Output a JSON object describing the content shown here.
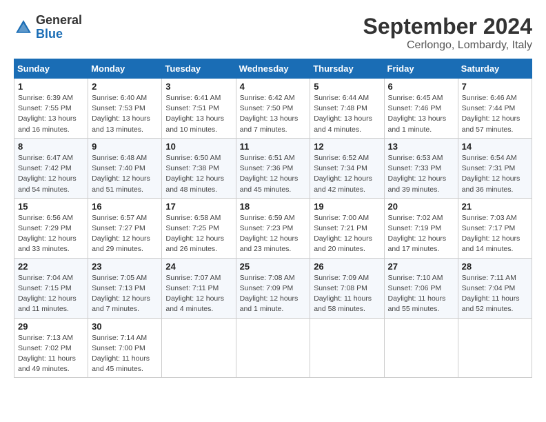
{
  "header": {
    "logo_general": "General",
    "logo_blue": "Blue",
    "month_year": "September 2024",
    "location": "Cerlongo, Lombardy, Italy"
  },
  "weekdays": [
    "Sunday",
    "Monday",
    "Tuesday",
    "Wednesday",
    "Thursday",
    "Friday",
    "Saturday"
  ],
  "weeks": [
    [
      {
        "day": "1",
        "info": "Sunrise: 6:39 AM\nSunset: 7:55 PM\nDaylight: 13 hours\nand 16 minutes."
      },
      {
        "day": "2",
        "info": "Sunrise: 6:40 AM\nSunset: 7:53 PM\nDaylight: 13 hours\nand 13 minutes."
      },
      {
        "day": "3",
        "info": "Sunrise: 6:41 AM\nSunset: 7:51 PM\nDaylight: 13 hours\nand 10 minutes."
      },
      {
        "day": "4",
        "info": "Sunrise: 6:42 AM\nSunset: 7:50 PM\nDaylight: 13 hours\nand 7 minutes."
      },
      {
        "day": "5",
        "info": "Sunrise: 6:44 AM\nSunset: 7:48 PM\nDaylight: 13 hours\nand 4 minutes."
      },
      {
        "day": "6",
        "info": "Sunrise: 6:45 AM\nSunset: 7:46 PM\nDaylight: 13 hours\nand 1 minute."
      },
      {
        "day": "7",
        "info": "Sunrise: 6:46 AM\nSunset: 7:44 PM\nDaylight: 12 hours\nand 57 minutes."
      }
    ],
    [
      {
        "day": "8",
        "info": "Sunrise: 6:47 AM\nSunset: 7:42 PM\nDaylight: 12 hours\nand 54 minutes."
      },
      {
        "day": "9",
        "info": "Sunrise: 6:48 AM\nSunset: 7:40 PM\nDaylight: 12 hours\nand 51 minutes."
      },
      {
        "day": "10",
        "info": "Sunrise: 6:50 AM\nSunset: 7:38 PM\nDaylight: 12 hours\nand 48 minutes."
      },
      {
        "day": "11",
        "info": "Sunrise: 6:51 AM\nSunset: 7:36 PM\nDaylight: 12 hours\nand 45 minutes."
      },
      {
        "day": "12",
        "info": "Sunrise: 6:52 AM\nSunset: 7:34 PM\nDaylight: 12 hours\nand 42 minutes."
      },
      {
        "day": "13",
        "info": "Sunrise: 6:53 AM\nSunset: 7:33 PM\nDaylight: 12 hours\nand 39 minutes."
      },
      {
        "day": "14",
        "info": "Sunrise: 6:54 AM\nSunset: 7:31 PM\nDaylight: 12 hours\nand 36 minutes."
      }
    ],
    [
      {
        "day": "15",
        "info": "Sunrise: 6:56 AM\nSunset: 7:29 PM\nDaylight: 12 hours\nand 33 minutes."
      },
      {
        "day": "16",
        "info": "Sunrise: 6:57 AM\nSunset: 7:27 PM\nDaylight: 12 hours\nand 29 minutes."
      },
      {
        "day": "17",
        "info": "Sunrise: 6:58 AM\nSunset: 7:25 PM\nDaylight: 12 hours\nand 26 minutes."
      },
      {
        "day": "18",
        "info": "Sunrise: 6:59 AM\nSunset: 7:23 PM\nDaylight: 12 hours\nand 23 minutes."
      },
      {
        "day": "19",
        "info": "Sunrise: 7:00 AM\nSunset: 7:21 PM\nDaylight: 12 hours\nand 20 minutes."
      },
      {
        "day": "20",
        "info": "Sunrise: 7:02 AM\nSunset: 7:19 PM\nDaylight: 12 hours\nand 17 minutes."
      },
      {
        "day": "21",
        "info": "Sunrise: 7:03 AM\nSunset: 7:17 PM\nDaylight: 12 hours\nand 14 minutes."
      }
    ],
    [
      {
        "day": "22",
        "info": "Sunrise: 7:04 AM\nSunset: 7:15 PM\nDaylight: 12 hours\nand 11 minutes."
      },
      {
        "day": "23",
        "info": "Sunrise: 7:05 AM\nSunset: 7:13 PM\nDaylight: 12 hours\nand 7 minutes."
      },
      {
        "day": "24",
        "info": "Sunrise: 7:07 AM\nSunset: 7:11 PM\nDaylight: 12 hours\nand 4 minutes."
      },
      {
        "day": "25",
        "info": "Sunrise: 7:08 AM\nSunset: 7:09 PM\nDaylight: 12 hours\nand 1 minute."
      },
      {
        "day": "26",
        "info": "Sunrise: 7:09 AM\nSunset: 7:08 PM\nDaylight: 11 hours\nand 58 minutes."
      },
      {
        "day": "27",
        "info": "Sunrise: 7:10 AM\nSunset: 7:06 PM\nDaylight: 11 hours\nand 55 minutes."
      },
      {
        "day": "28",
        "info": "Sunrise: 7:11 AM\nSunset: 7:04 PM\nDaylight: 11 hours\nand 52 minutes."
      }
    ],
    [
      {
        "day": "29",
        "info": "Sunrise: 7:13 AM\nSunset: 7:02 PM\nDaylight: 11 hours\nand 49 minutes."
      },
      {
        "day": "30",
        "info": "Sunrise: 7:14 AM\nSunset: 7:00 PM\nDaylight: 11 hours\nand 45 minutes."
      },
      {
        "day": "",
        "info": ""
      },
      {
        "day": "",
        "info": ""
      },
      {
        "day": "",
        "info": ""
      },
      {
        "day": "",
        "info": ""
      },
      {
        "day": "",
        "info": ""
      }
    ]
  ]
}
